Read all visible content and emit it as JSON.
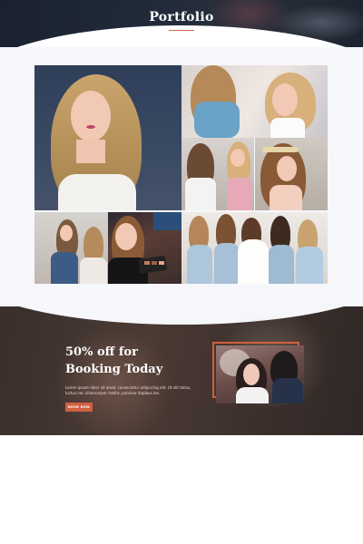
{
  "header": {
    "title": "Portfolio"
  },
  "gallery": {
    "tiles": [
      {
        "name": "portfolio-photo-blonde-portrait"
      },
      {
        "name": "portfolio-photo-bridal-makeup-application"
      },
      {
        "name": "portfolio-photo-makeup-artist-client"
      },
      {
        "name": "portfolio-photo-braided-updo"
      },
      {
        "name": "portfolio-photo-salon-session"
      },
      {
        "name": "portfolio-photo-makeup-palette"
      },
      {
        "name": "portfolio-photo-bridal-party"
      }
    ]
  },
  "promo": {
    "heading_line1": "50% off for",
    "heading_line2": "Booking Today",
    "body": "Lorem ipsum dolor sit amet, consectetur adipiscing elit. Ut elit tellus, luctus nec ullamcorper mattis, pulvinar dapibus leo.",
    "button_label": "BOOK NOW"
  },
  "colors": {
    "accent": "#d2603f",
    "header_dark": "#1e2634",
    "gallery_bg": "#f6f7fb",
    "promo_dark": "#3f322e"
  }
}
